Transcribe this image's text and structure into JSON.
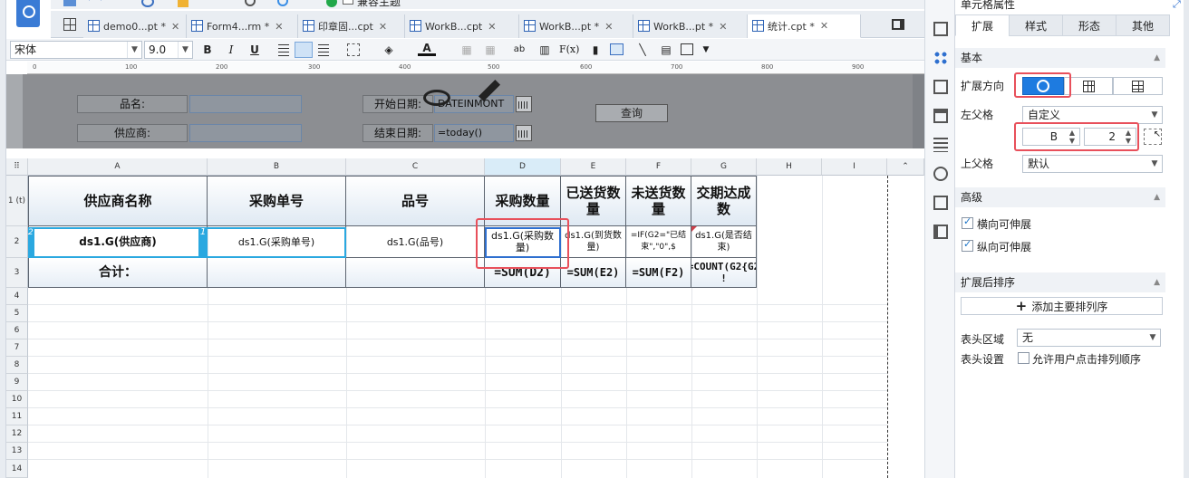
{
  "tabs": [
    {
      "label": "demo0...pt *"
    },
    {
      "label": "Form4...rm *"
    },
    {
      "label": "印章固...cpt"
    },
    {
      "label": "WorkB...cpt"
    },
    {
      "label": "WorkB...pt *"
    },
    {
      "label": "WorkB...pt *"
    },
    {
      "label": "统计.cpt *"
    }
  ],
  "toolbar": {
    "theme_label": "兼容主题"
  },
  "format": {
    "font": "宋体",
    "size": "9.0",
    "bold": "B",
    "italic": "I",
    "underline": "U",
    "fx": "F(x)",
    "ab": "ab"
  },
  "ruler": [
    "0",
    "100",
    "200",
    "300",
    "400",
    "500",
    "600",
    "700",
    "800",
    "900"
  ],
  "design": {
    "name_label": "品名:",
    "supplier_label": "供应商:",
    "start_label": "开始日期:",
    "start_value": "DATEINMONT",
    "end_label": "结束日期:",
    "end_value": "=today()",
    "query_button": "查询"
  },
  "grid": {
    "columns": [
      "A",
      "B",
      "C",
      "D",
      "E",
      "F",
      "G",
      "H",
      "I"
    ],
    "rows": [
      "1 (t)",
      "2",
      "3",
      "4",
      "5",
      "6",
      "7",
      "8",
      "9",
      "10",
      "11",
      "12",
      "13",
      "14"
    ],
    "header_cells": [
      "供应商名称",
      "采购单号",
      "品号",
      "采购数量",
      "已送货数量",
      "未送货数量",
      "交期达成数"
    ],
    "row2": [
      "ds1.G(供应商)",
      "ds1.G(采购单号)",
      "ds1.G(品号)",
      "ds1.G(采购数量)",
      "ds1.G(到货数量)",
      "=IF(G2=\"已结束\",\"0\",$",
      "ds1.G(是否结束)"
    ],
    "row3": [
      "合计：",
      "",
      "",
      "=SUM(D2)",
      "=SUM(E2)",
      "=SUM(F2)",
      "=COUNT(G2{G2 !"
    ],
    "markers": [
      "2",
      "1"
    ]
  },
  "panel": {
    "title": "单元格属性",
    "tabs": [
      "扩展",
      "样式",
      "形态",
      "其他"
    ],
    "basic_section": "基本",
    "expand_dir_label": "扩展方向",
    "left_parent_label": "左父格",
    "left_parent_value": "自定义",
    "left_parent_col": "B",
    "left_parent_row": "2",
    "top_parent_label": "上父格",
    "top_parent_value": "默认",
    "advanced_section": "高级",
    "h_expand_label": "横向可伸展",
    "v_expand_label": "纵向可伸展",
    "sort_section": "扩展后排序",
    "add_sort_button": "添加主要排列序",
    "header_area_label": "表头区域",
    "header_area_value": "无",
    "header_settings_label": "表头设置",
    "allow_sort_label": "允许用户点击排列顺序"
  },
  "colors": {
    "accent": "#1a73c8",
    "highlight": "#e8505b",
    "selection": "#2aa8e0"
  }
}
